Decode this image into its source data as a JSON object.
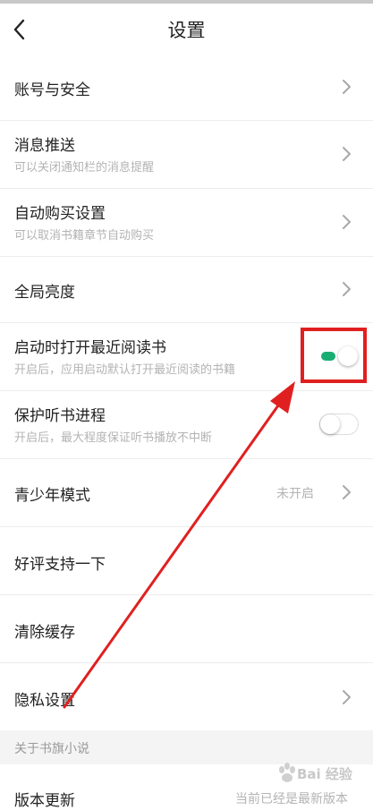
{
  "header": {
    "title": "设置"
  },
  "items": {
    "account": {
      "label": "账号与安全"
    },
    "push": {
      "label": "消息推送",
      "sub": "可以关闭通知栏的消息提醒"
    },
    "autobuy": {
      "label": "自动购买设置",
      "sub": "可以取消书籍章节自动购买"
    },
    "brightness": {
      "label": "全局亮度"
    },
    "open_recent": {
      "label": "启动时打开最近阅读书",
      "sub": "开启后，应用启动默认打开最近阅读的书籍",
      "enabled": true
    },
    "protect_audio": {
      "label": "保护听书进程",
      "sub": "开启后，最大程度保证听书播放不中断",
      "enabled": false
    },
    "youth": {
      "label": "青少年模式",
      "value": "未开启"
    },
    "rate": {
      "label": "好评支持一下"
    },
    "clear_cache": {
      "label": "清除缓存"
    },
    "privacy": {
      "label": "隐私设置"
    }
  },
  "section_about": {
    "label": "关于书旗小说"
  },
  "version": {
    "label": "版本更新",
    "value": "当前已经是最新版本"
  },
  "watermark": {
    "text": "Bai 经验"
  },
  "colors": {
    "accent": "#1aad72",
    "annotation": "#e02020"
  }
}
